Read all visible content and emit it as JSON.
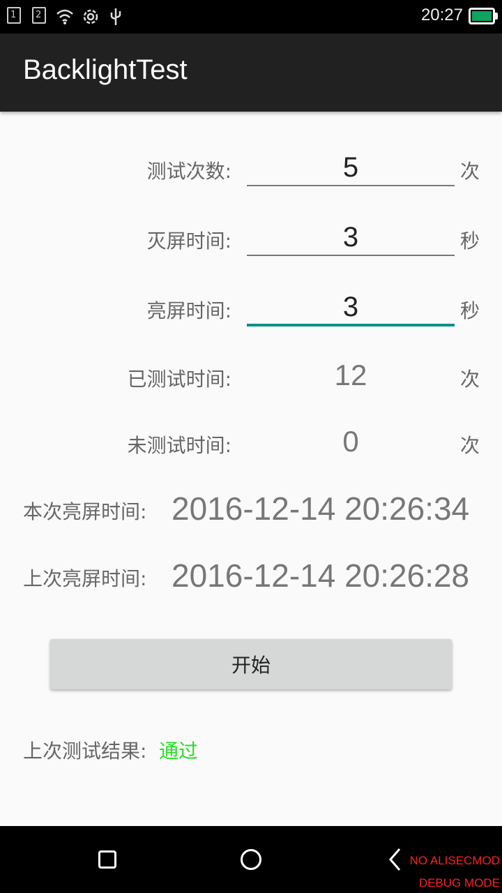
{
  "status_bar": {
    "sim1": "1",
    "sim2": "2",
    "time": "20:27",
    "icons": [
      "sim1-icon",
      "sim2-icon",
      "wifi-icon",
      "settings-icon",
      "usb-icon",
      "battery-icon"
    ],
    "battery_color": "#0ea35f"
  },
  "app_bar": {
    "title": "BacklightTest",
    "background": "#212121"
  },
  "form": {
    "test_count": {
      "label": "测试次数:",
      "value": "5",
      "unit": "次"
    },
    "screen_off_time": {
      "label": "灭屏时间:",
      "value": "3",
      "unit": "秒"
    },
    "screen_on_time": {
      "label": "亮屏时间:",
      "value": "3",
      "unit": "秒"
    },
    "tested": {
      "label": "已测试时间:",
      "value": "12",
      "unit": "次"
    },
    "untested": {
      "label": "未测试时间:",
      "value": "0",
      "unit": "次"
    }
  },
  "times": {
    "current": {
      "label": "本次亮屏时间:",
      "value": "2016-12-14 20:26:34"
    },
    "previous": {
      "label": "上次亮屏时间:",
      "value": "2016-12-14 20:26:28"
    }
  },
  "start_button": {
    "label": "开始"
  },
  "result": {
    "label": "上次测试结果:",
    "value": "通过",
    "value_color": "#22e022"
  },
  "accent_color": "#0e9088",
  "nav_bar": {
    "icons": [
      "recents-icon",
      "home-icon",
      "back-icon"
    ],
    "debug_line1": "NO ALISECMOD",
    "debug_line2": "DEBUG MODE"
  }
}
